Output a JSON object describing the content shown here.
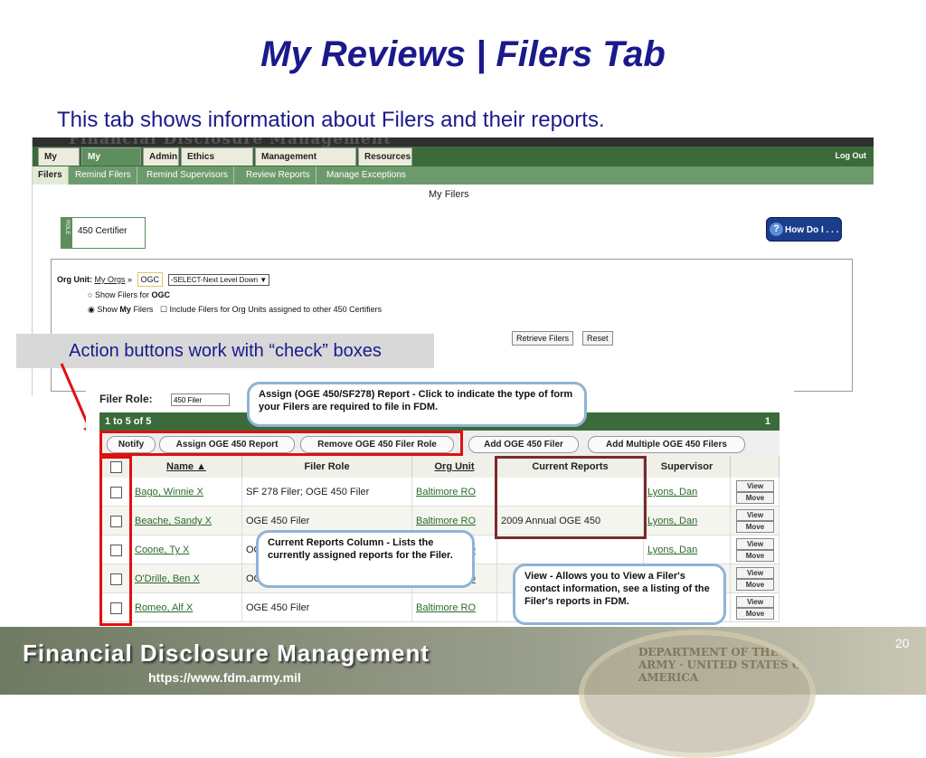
{
  "slide": {
    "title": "My Reviews | Filers Tab",
    "subtitle": "This tab shows information about Filers and their reports.",
    "page_number": "20"
  },
  "app": {
    "banner": "Financial Disclosure Management",
    "tabs": [
      "My Info",
      "My Reviews",
      "Admin",
      "Ethics Training",
      "Management Reports",
      "Resources"
    ],
    "active_tab": "My Reviews",
    "logout": "Log Out",
    "subtabs": [
      "Filers",
      "Remind Filers",
      "Remind Supervisors",
      "Review Reports",
      "Manage Exceptions"
    ],
    "page_heading": "My Filers",
    "role_strip": "ROLE",
    "role_value": "450 Certifier",
    "how_do_i": "How Do I . . .",
    "org_unit_label": "Org Unit:",
    "my_orgs_link": "My Orgs",
    "org_value": "OGC",
    "select_next_level": "-SELECT-Next Level Down",
    "radio_show_filers_for": "Show Filers for",
    "radio_show_filers_org": "OGC",
    "radio_show_my": "Show",
    "radio_show_my_bold": "My",
    "radio_show_my_tail": "Filers",
    "include_checkbox_label": "Include Filers for Org Units assigned to other 450 Certifiers",
    "retrieve_button": "Retrieve Filers",
    "reset_button": "Reset"
  },
  "callout_action": "Action buttons work with “check” boxes",
  "filers": {
    "filer_role_label": "Filer Role:",
    "filer_role_value": "450 Filer",
    "range_text": "1 to 5 of 5",
    "page": "1",
    "actions": [
      "Notify",
      "Assign OGE 450 Report",
      "Remove OGE 450 Filer Role",
      "Add OGE 450 Filer",
      "Add Multiple OGE 450 Filers"
    ],
    "columns": [
      "Name ▲",
      "Filer Role",
      "Org Unit",
      "Current Reports",
      "Supervisor"
    ],
    "rows": [
      {
        "name": "Bago, Winnie X",
        "role": "SF 278 Filer; OGE 450 Filer",
        "org": "Baltimore RO",
        "reports": "",
        "supervisor": "Lyons, Dan"
      },
      {
        "name": "Beache, Sandy X",
        "role": "OGE 450 Filer",
        "org": "Baltimore RO",
        "reports": "2009 Annual OGE 450",
        "supervisor": "Lyons, Dan"
      },
      {
        "name": "Coone, Ty X",
        "role": "OGE 450 Filer",
        "org": "Baltimore RO",
        "reports": "",
        "supervisor": "Lyons, Dan"
      },
      {
        "name": "O'Drille, Ben X",
        "role": "OGE 450 Filer",
        "org": "Baltimore RO",
        "reports": "",
        "supervisor": "Lyons, Dan"
      },
      {
        "name": "Romeo, Alf X",
        "role": "OGE 450 Filer",
        "org": "Baltimore RO",
        "reports": "",
        "supervisor": "Lyons, Dan"
      }
    ],
    "view_label": "View",
    "move_label": "Move"
  },
  "callouts": {
    "assign": "Assign (OGE 450/SF278) Report  - Click to indicate the type of form your Filers are required to file in FDM.",
    "current_reports": "Current Reports Column - Lists the currently assigned reports for the Filer.",
    "view": "View - Allows you to View a Filer's contact information, see a listing of the Filer's reports in FDM."
  },
  "footer": {
    "title": "Financial Disclosure Management",
    "url": "https://www.fdm.army.mil",
    "seal_text": "DEPARTMENT OF THE ARMY · UNITED STATES OF AMERICA"
  },
  "colors": {
    "title": "#1a1a8c",
    "tab_green": "#3b6b3b",
    "highlight_red": "#e01010",
    "callout_border": "#8fb3d6"
  }
}
